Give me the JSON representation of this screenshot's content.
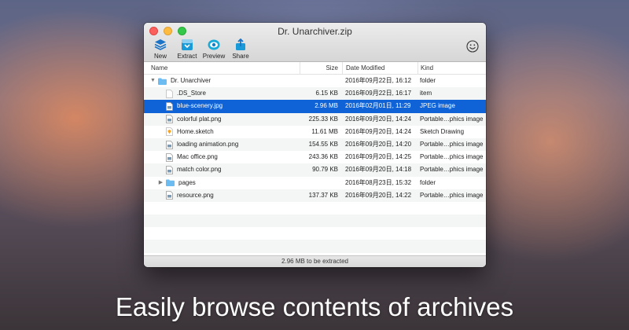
{
  "window": {
    "title": "Dr. Unarchiver.zip"
  },
  "toolbar": {
    "buttons": [
      {
        "label": "New",
        "icon": "layers-icon"
      },
      {
        "label": "Extract",
        "icon": "extract-icon"
      },
      {
        "label": "Preview",
        "icon": "eye-icon"
      },
      {
        "label": "Share",
        "icon": "share-icon"
      }
    ],
    "feedback_icon": "smiley-icon"
  },
  "columns": {
    "name": "Name",
    "size": "Size",
    "date": "Date Modified",
    "kind": "Kind"
  },
  "files": [
    {
      "name": "Dr. Unarchiver",
      "size": "",
      "date": "2016年09月22日, 16:12",
      "kind": "folder",
      "type": "folder",
      "expanded": true,
      "indent": 0
    },
    {
      "name": ".DS_Store",
      "size": "6.15 KB",
      "date": "2016年09月22日, 16:17",
      "kind": "item",
      "type": "blank",
      "indent": 1
    },
    {
      "name": "blue-scenery.jpg",
      "size": "2.96 MB",
      "date": "2016年02月01日, 11:29",
      "kind": "JPEG image",
      "type": "image",
      "indent": 1,
      "selected": true
    },
    {
      "name": "colorful plat.png",
      "size": "225.33 KB",
      "date": "2016年09月20日, 14:24",
      "kind": "Portable…phics image",
      "type": "image",
      "indent": 1
    },
    {
      "name": "Home.sketch",
      "size": "11.61 MB",
      "date": "2016年09月20日, 14:24",
      "kind": "Sketch Drawing",
      "type": "sketch",
      "indent": 1
    },
    {
      "name": "loading animation.png",
      "size": "154.55 KB",
      "date": "2016年09月20日, 14:20",
      "kind": "Portable…phics image",
      "type": "image",
      "indent": 1
    },
    {
      "name": "Mac office.png",
      "size": "243.36 KB",
      "date": "2016年09月20日, 14:25",
      "kind": "Portable…phics image",
      "type": "image",
      "indent": 1
    },
    {
      "name": "match color.png",
      "size": "90.79 KB",
      "date": "2016年09月20日, 14:18",
      "kind": "Portable…phics image",
      "type": "image",
      "indent": 1
    },
    {
      "name": "pages",
      "size": "",
      "date": "2016年08月23日, 15:32",
      "kind": "folder",
      "type": "folder",
      "expanded": false,
      "indent": 1
    },
    {
      "name": "resource.png",
      "size": "137.37 KB",
      "date": "2016年09月20日, 14:22",
      "kind": "Portable…phics image",
      "type": "image",
      "indent": 1
    }
  ],
  "empty_rows": 5,
  "status": "2.96 MB to be extracted",
  "caption": "Easily browse contents of archives",
  "colors": {
    "selection": "#0f63d6",
    "folder": "#6cbcf2",
    "sketch": "#f5a623"
  }
}
